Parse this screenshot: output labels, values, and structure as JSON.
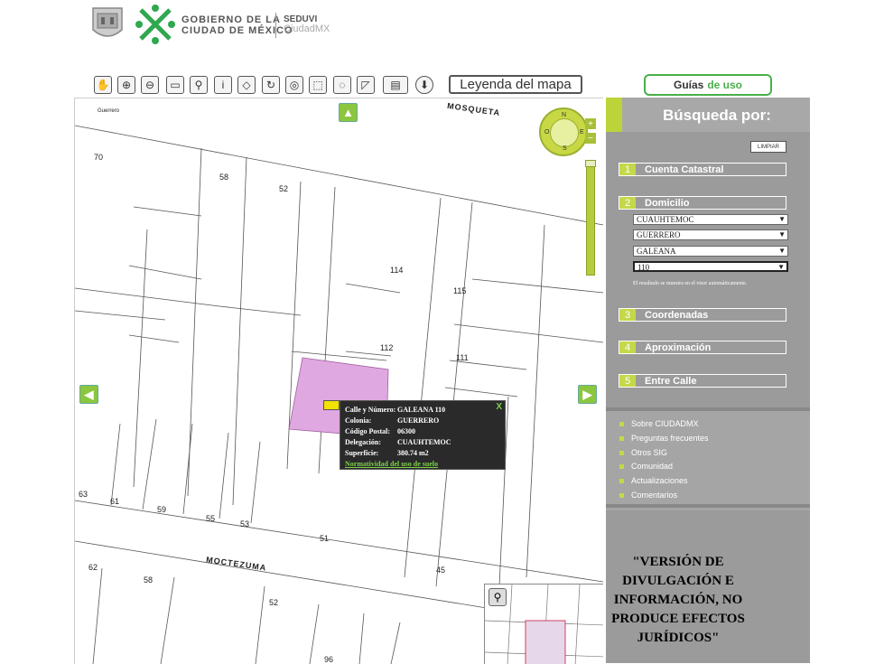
{
  "header": {
    "gov_line1": "GOBIERNO DE LA",
    "gov_line2": "CIUDAD DE MÉXICO",
    "seduvi": "SEDUVI",
    "ciudadmx": "CiudadMX"
  },
  "toolbar": {
    "tools": [
      "pan-hand-icon",
      "zoom-in-icon",
      "zoom-out-icon",
      "measure-icon",
      "walk-icon",
      "info-icon",
      "eraser-icon",
      "refresh-icon",
      "identify-icon",
      "select-icon",
      "lasso-icon",
      "polygon-select-icon",
      "print-icon",
      "download-icon"
    ],
    "legend_label": "Leyenda del mapa",
    "guides_label": "Guías",
    "guides_label_green": "de uso"
  },
  "map": {
    "streets": [
      "MOSQUETA",
      "MOCTEZUMA",
      "Guerrero"
    ],
    "lots": [
      "70",
      "58",
      "52",
      "114",
      "115",
      "112",
      "111",
      "63",
      "61",
      "59",
      "55",
      "53",
      "51",
      "62",
      "58",
      "52",
      "96",
      "45"
    ],
    "compass": {
      "n": "N",
      "s": "S",
      "e": "E",
      "o": "O"
    },
    "zoom_plus": "+",
    "zoom_minus": "−"
  },
  "popup": {
    "fields": [
      {
        "k": "Calle y Número:",
        "v": "GALEANA 110"
      },
      {
        "k": "Colonia:",
        "v": "GUERRERO"
      },
      {
        "k": "Código Postal:",
        "v": "06300"
      },
      {
        "k": "Delegación:",
        "v": "CUAUHTEMOC"
      },
      {
        "k": "Superficie:",
        "v": "380.74 m2"
      }
    ],
    "link": "Normatividad del uso de suelo",
    "close": "X"
  },
  "sidebar": {
    "title": "Búsqueda por:",
    "clear": "LIMPIAR",
    "sections": [
      {
        "num": "1",
        "label": "Cuenta Catastral"
      },
      {
        "num": "2",
        "label": "Domicilio"
      },
      {
        "num": "3",
        "label": "Coordenadas"
      },
      {
        "num": "4",
        "label": "Aproximación"
      },
      {
        "num": "5",
        "label": "Entre Calle"
      }
    ],
    "selects": [
      "CUAUHTEMOC",
      "GUERRERO",
      "GALEANA",
      "110"
    ],
    "note": "El resultado se muestra en el visor automáticamente.",
    "links": [
      "Sobre CIUDADMX",
      "Preguntas frecuentes",
      "Otros SIG",
      "Comunidad",
      "Actualizaciones",
      "Comentarios"
    ],
    "disclaimer": "\"VERSIÓN DE DIVULGACIÓN E INFORMACIÓN, NO PRODUCE EFECTOS JURÍDICOS\""
  },
  "colors": {
    "accent": "#bcd33a",
    "highlight_lot": "#e0a8e0",
    "sidebar": "#9b9b9b"
  }
}
